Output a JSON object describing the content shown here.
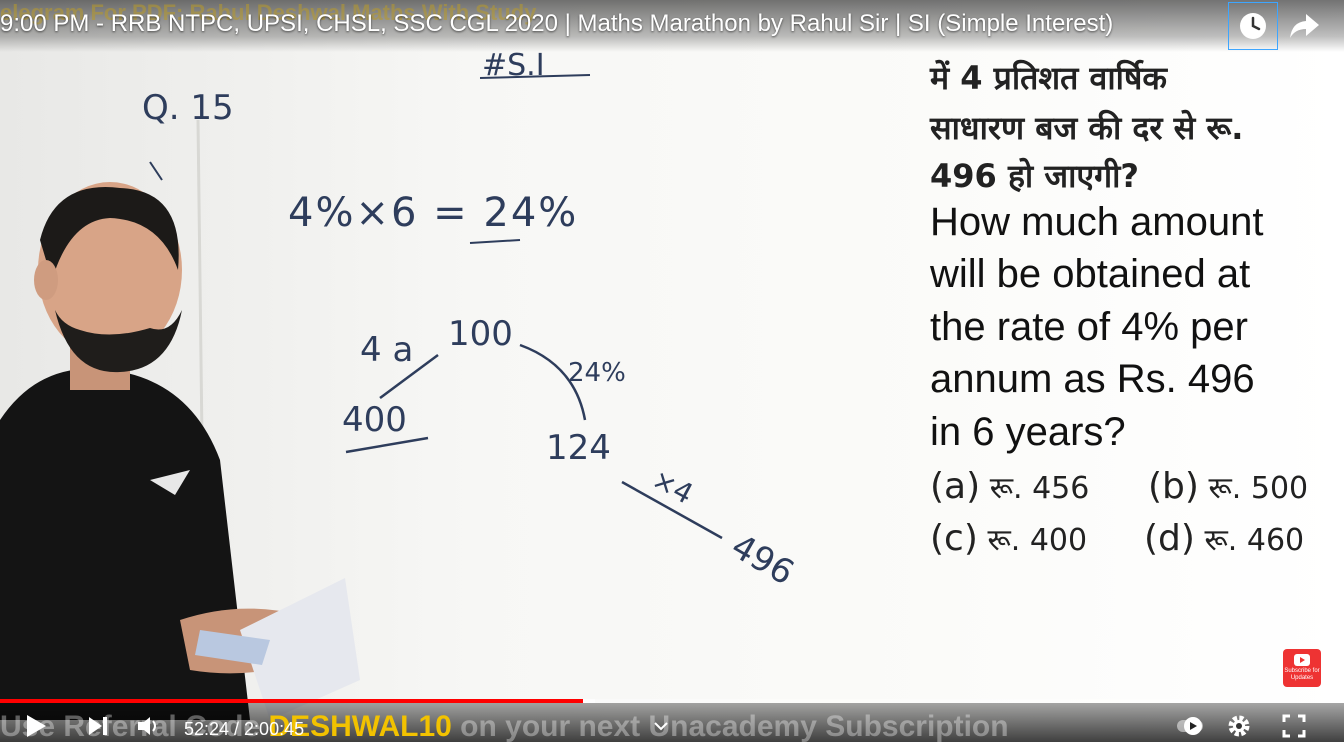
{
  "video": {
    "title": "9:00 PM - RRB NTPC, UPSI, CHSL, SSC CGL 2020 | Maths Marathon by Rahul Sir | SI (Simple Interest)",
    "top_banner": "elegram For PDF: Rahul Deshwal Maths With Study"
  },
  "whiteboard": {
    "header": "#S.I",
    "question_no": "Q. 15",
    "step1": "4%×6 = 24%",
    "label_4a": "4 a",
    "value_100": "100",
    "value_400": "400",
    "percent_24": "24%",
    "value_124": "124",
    "mult_x4": "×4",
    "value_496": "496"
  },
  "question": {
    "hindi_lines": [
      "में 4 प्रतिशत वार्षिक",
      "साधारण बज की दर से रू.",
      "496 हो जाएगी?"
    ],
    "english_lines": [
      "How much amount",
      "will be obtained at",
      "the rate of 4% per",
      "annum as Rs. 496",
      "in 6 years?"
    ],
    "options": [
      {
        "key": "(a)",
        "value": "रू. 456"
      },
      {
        "key": "(b)",
        "value": "रू. 500"
      },
      {
        "key": "(c)",
        "value": "रू. 400"
      },
      {
        "key": "(d)",
        "value": "रू. 460"
      }
    ]
  },
  "player": {
    "current_time": "52:24",
    "duration": "2:00:45",
    "time_display": "52:24 / 2:00:45",
    "progress_fraction": 0.434,
    "buffer_fraction": 0.443,
    "ticker_prefix": "Use Referral Code ",
    "ticker_code": "DESHWAL10",
    "ticker_suffix": " on your next Unacademy Subscription",
    "subscribe_label": "Subscribe for Updates",
    "progress_color": "#ff0000"
  }
}
